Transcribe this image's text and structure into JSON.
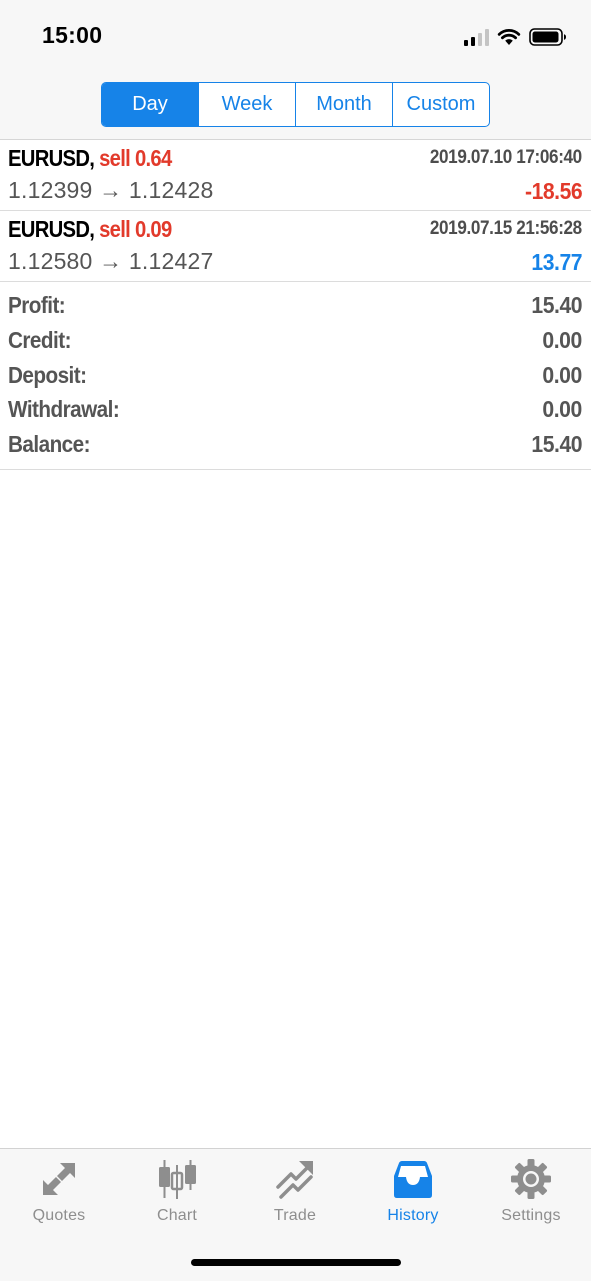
{
  "status_bar": {
    "time": "15:00"
  },
  "periods": [
    {
      "label": "Day",
      "active": true
    },
    {
      "label": "Week",
      "active": false
    },
    {
      "label": "Month",
      "active": false
    },
    {
      "label": "Custom",
      "active": false
    }
  ],
  "deals": [
    {
      "symbol": "EURUSD,",
      "side": "sell 0.64",
      "datetime": "2019.07.10 17:06:40",
      "prices": "1.12399 → 1.12428",
      "profit": "-18.56"
    },
    {
      "symbol": "EURUSD,",
      "side": "sell 0.09",
      "datetime": "2019.07.15 21:56:28",
      "prices": "1.12580 → 1.12427",
      "profit": "13.77"
    }
  ],
  "summary": [
    {
      "label": "Profit:",
      "value": "15.40"
    },
    {
      "label": "Credit:",
      "value": "0.00"
    },
    {
      "label": "Deposit:",
      "value": "0.00"
    },
    {
      "label": "Withdrawal:",
      "value": "0.00"
    },
    {
      "label": "Balance:",
      "value": "15.40"
    }
  ],
  "tabs": [
    {
      "label": "Quotes",
      "icon": "quotes-arrows-icon",
      "active": false
    },
    {
      "label": "Chart",
      "icon": "candlestick-chart-icon",
      "active": false
    },
    {
      "label": "Trade",
      "icon": "trade-trend-icon",
      "active": false
    },
    {
      "label": "History",
      "icon": "history-inbox-icon",
      "active": true
    },
    {
      "label": "Settings",
      "icon": "settings-gear-icon",
      "active": false
    }
  ],
  "colors": {
    "accent": "#1683e8",
    "loss": "#e23a2b",
    "inactive_icon": "#8e8e8e"
  }
}
